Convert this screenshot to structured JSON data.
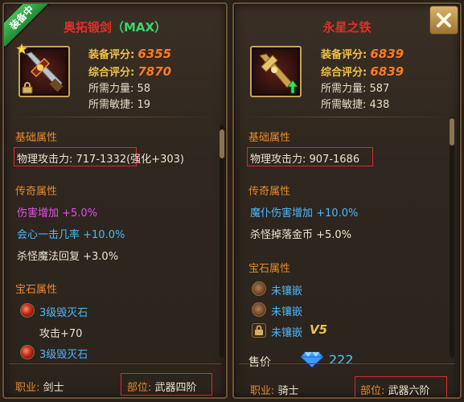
{
  "left": {
    "badge": "装备中",
    "title": "奥拓锻剑",
    "title_suffix": "（MAX）",
    "stats": {
      "equip_score_label": "装备评分:",
      "equip_score": "6355",
      "overall_score_label": "综合评分:",
      "overall_score": "7870",
      "req_str": "所需力量: 58",
      "req_agi": "所需敏捷: 19"
    },
    "base_title": "基础属性",
    "base_attack": "物理攻击力: 717-1332",
    "base_attack_extra": "(强化+303)",
    "legend_title": "传奇属性",
    "legend_1": "伤害增加 +5.0%",
    "legend_2": "会心一击几率 +10.0%",
    "legend_3": "杀怪魔法回复 +3.0%",
    "gem_title": "宝石属性",
    "gem_1": "3级毁灭石",
    "gem_1_bonus": "攻击+70",
    "gem_2": "3级毁灭石",
    "job_label": "职业:",
    "job_value": "剑士",
    "slot_label": "部位:",
    "slot_value": "武器四阶"
  },
  "right": {
    "title": "永星之铁",
    "stats": {
      "equip_score_label": "装备评分:",
      "equip_score": "6839",
      "overall_score_label": "综合评分:",
      "overall_score": "6839",
      "req_str": "所需力量: 587",
      "req_agi": "所需敏捷: 438"
    },
    "base_title": "基础属性",
    "base_attack": "物理攻击力: 907-1686",
    "legend_title": "传奇属性",
    "legend_1": "魔仆伤害增加 +10.0%",
    "legend_2": "杀怪掉落金币 +5.0%",
    "gem_title": "宝石属性",
    "gem_1": "未镶嵌",
    "gem_2": "未镶嵌",
    "gem_3": "未镶嵌",
    "vip": "V5",
    "price_label": "售价",
    "price_value": "222",
    "job_label": "职业:",
    "job_value": "骑士",
    "slot_label": "部位:",
    "slot_value": "武器六阶"
  },
  "icons": [
    "star-icon",
    "lock-icon",
    "upgrade-arrow-icon",
    "diamond-icon",
    "close-icon"
  ]
}
